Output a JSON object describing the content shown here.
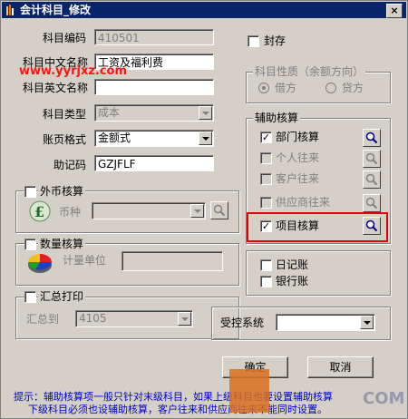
{
  "window": {
    "title": "会计科目_修改",
    "close_glyph": "×"
  },
  "form": {
    "code_label": "科目编码",
    "code_value": "410501",
    "cn_name_label": "科目中文名称",
    "cn_name_value": "工资及福利费",
    "en_name_label": "科目英文名称",
    "en_name_value": "",
    "type_label": "科目类型",
    "type_value": "成本",
    "page_format_label": "账页格式",
    "page_format_value": "金额式",
    "mnemonic_label": "助记码",
    "mnemonic_value": "GZJFLF"
  },
  "seal": {
    "label": "封存"
  },
  "nature": {
    "title": "科目性质（余额方向）",
    "debit": "借方",
    "credit": "贷方"
  },
  "aux": {
    "title": "辅助核算",
    "items": [
      {
        "label": "部门核算",
        "checked": true
      },
      {
        "label": "个人往来",
        "checked": false
      },
      {
        "label": "客户往来",
        "checked": false
      },
      {
        "label": "供应商往来",
        "checked": false
      },
      {
        "label": "项目核算",
        "checked": true
      }
    ]
  },
  "journal": {
    "daily": "日记账",
    "bank": "银行账"
  },
  "foreign": {
    "title": "外币核算",
    "currency_label": "币种"
  },
  "quantity": {
    "title": "数量核算",
    "unit_label": "计量单位"
  },
  "summary": {
    "title": "汇总打印",
    "to_label": "汇总到",
    "to_value": "4105"
  },
  "controlled": {
    "label": "受控系统"
  },
  "buttons": {
    "ok": "确定",
    "cancel": "取消"
  },
  "hint": {
    "line1": "提示：辅助核算项一般只针对末级科目，如果上级科目也要设置辅助核算",
    "line2": "下级科目必须也设辅助核算，客户往来和供应商往来不能同时设置。"
  },
  "watermarks": {
    "top": "www.yyrjxz.com",
    "bottom": "COM"
  },
  "colors": {
    "title_bg": "#0a246a",
    "accent_red": "#e00000",
    "hint_blue": "#0000cc"
  }
}
